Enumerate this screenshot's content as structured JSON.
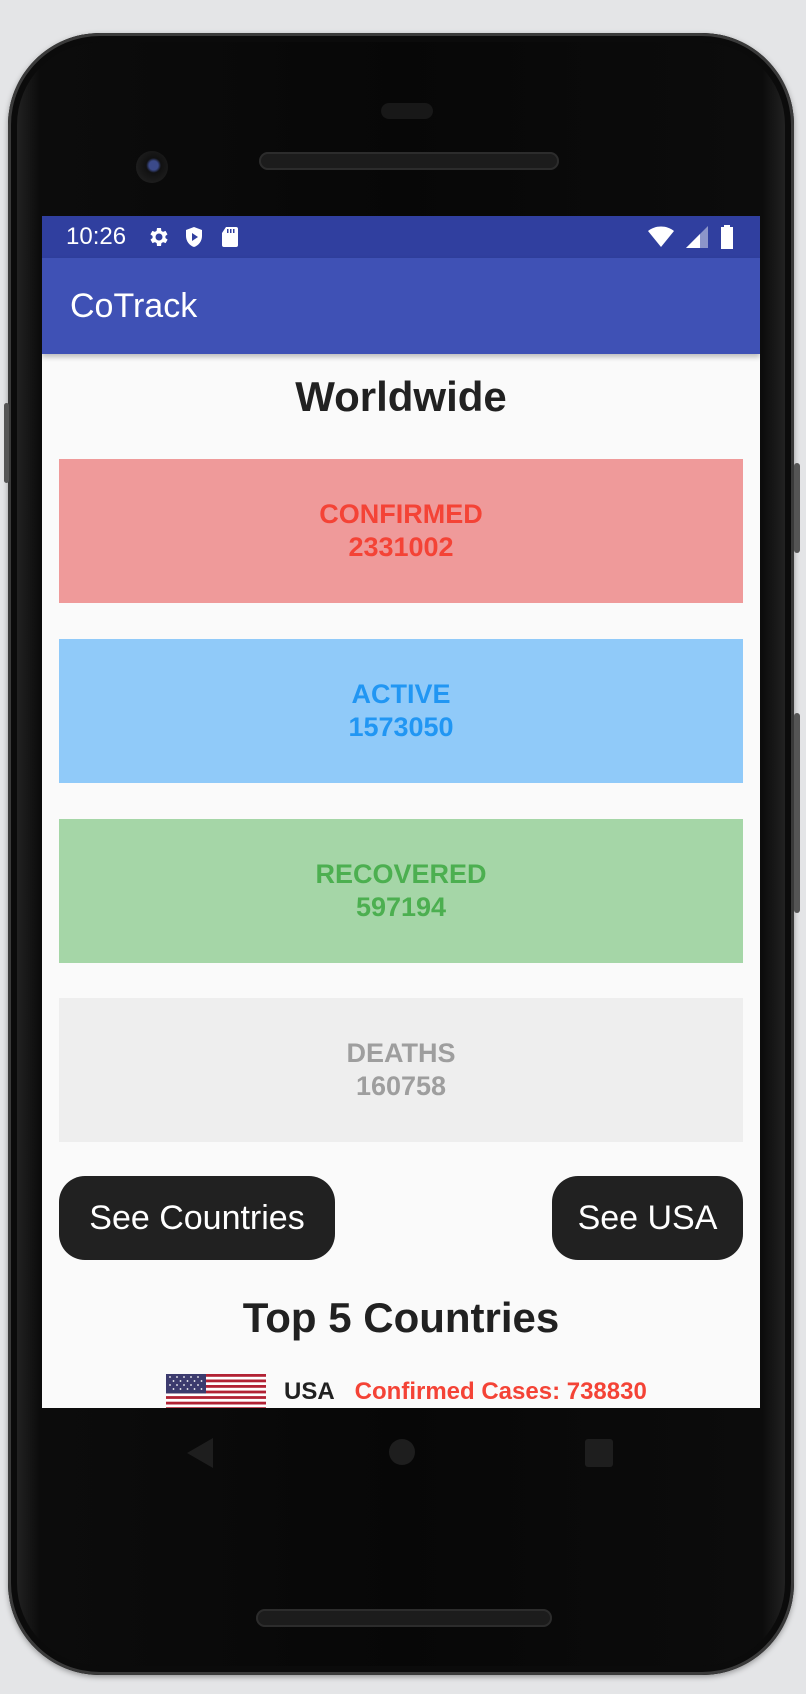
{
  "status_bar": {
    "time": "10:26",
    "icons_left": [
      "gear-icon",
      "shield-play-icon",
      "sd-card-icon"
    ],
    "icons_right": [
      "wifi-icon",
      "signal-icon",
      "battery-icon"
    ],
    "color": "#303f9f"
  },
  "app_bar": {
    "title": "CoTrack",
    "color": "#3f51b5"
  },
  "worldwide": {
    "heading": "Worldwide",
    "stats": {
      "confirmed": {
        "label": "CONFIRMED",
        "value": "2331002",
        "bg": "#ef9a9a",
        "fg": "#f44336"
      },
      "active": {
        "label": "ACTIVE",
        "value": "1573050",
        "bg": "#90caf9",
        "fg": "#2196f3"
      },
      "recovered": {
        "label": "RECOVERED",
        "value": "597194",
        "bg": "#a5d6a7",
        "fg": "#4caf50"
      },
      "deaths": {
        "label": "DEATHS",
        "value": "160758",
        "bg": "#eeeeee",
        "fg": "#9e9e9e"
      }
    }
  },
  "buttons": {
    "see_countries": "See Countries",
    "see_usa": "See USA"
  },
  "top_countries": {
    "heading": "Top 5 Countries",
    "items": [
      {
        "flag": "usa-flag-icon",
        "name": "USA",
        "cases": "Confirmed Cases: 738830"
      }
    ]
  },
  "nav_bar": {
    "icons": [
      "back-icon",
      "home-icon",
      "recents-icon"
    ]
  }
}
